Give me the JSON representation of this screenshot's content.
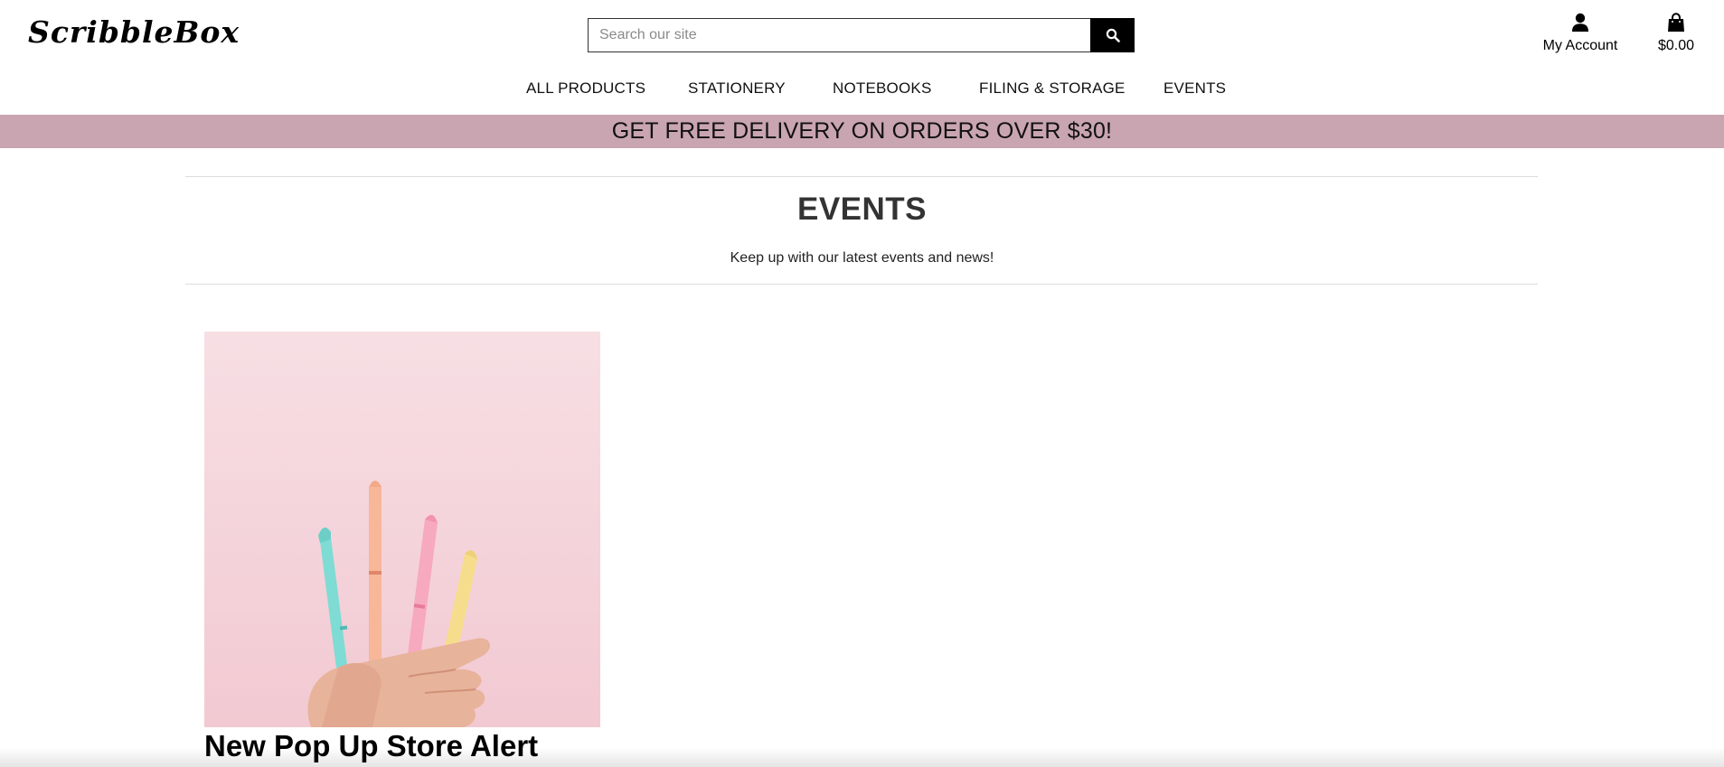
{
  "brand": {
    "logo": "ScribbleBox"
  },
  "search": {
    "placeholder": "Search our site",
    "value": ""
  },
  "account": {
    "label": "My Account",
    "icon": "user-icon"
  },
  "cart": {
    "total": "$0.00",
    "icon": "shopping-bag-icon"
  },
  "nav": {
    "items": [
      {
        "label": "ALL PRODUCTS"
      },
      {
        "label": "STATIONERY"
      },
      {
        "label": "NOTEBOOKS"
      },
      {
        "label": "FILING & STORAGE"
      },
      {
        "label": "EVENTS"
      }
    ]
  },
  "banner": {
    "text": "GET FREE DELIVERY ON ORDERS OVER $30!",
    "color": "#c9a4b1"
  },
  "page": {
    "title": "EVENTS",
    "subtitle": "Keep up with our latest events and news!"
  },
  "events": [
    {
      "title": "New Pop Up Store Alert",
      "image": "pastel-highlighters-in-hand"
    }
  ]
}
